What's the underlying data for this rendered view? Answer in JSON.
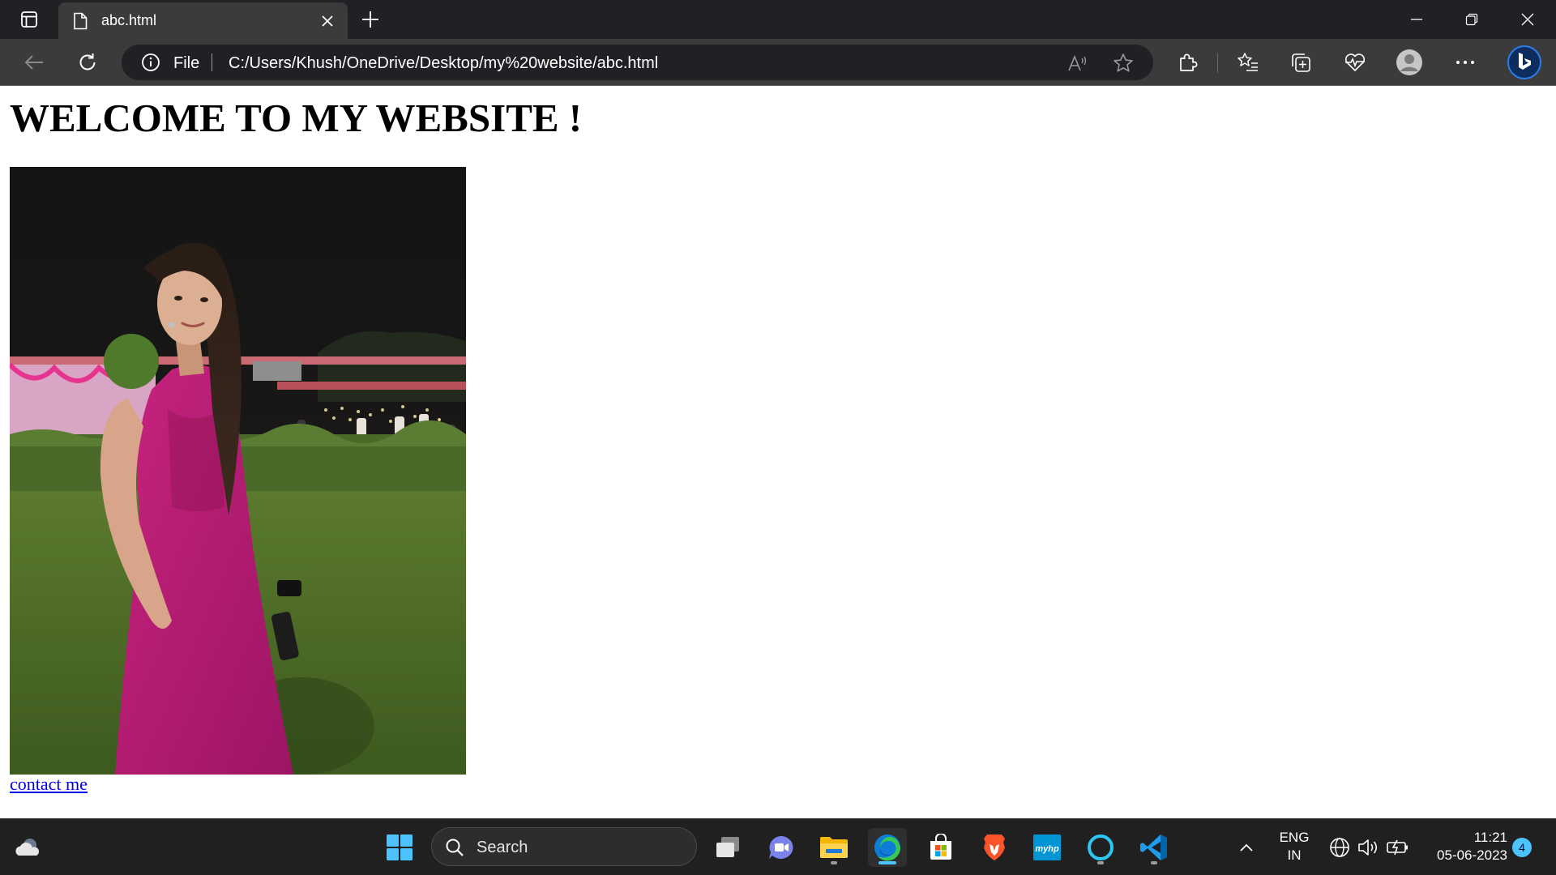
{
  "browser": {
    "tab": {
      "title": "abc.html"
    },
    "address": {
      "scheme_label": "File",
      "url": "C:/Users/Khush/OneDrive/Desktop/my%20website/abc.html"
    }
  },
  "page": {
    "heading": "WELCOME TO MY WEBSITE !",
    "photo_alt": "",
    "link_text": "contact me"
  },
  "taskbar": {
    "search_label": "Search",
    "lang_line1": "ENG",
    "lang_line2": "IN",
    "time": "11:21",
    "date": "05-06-2023",
    "notification_count": "4",
    "apps": [
      "start",
      "search",
      "task-view",
      "teams",
      "file-explorer",
      "edge",
      "microsoft-store",
      "brave",
      "myhp",
      "cortana",
      "vscode"
    ]
  },
  "colors": {
    "tabstrip_bg": "#202124",
    "toolbar_bg": "#3b3b3b",
    "taskbar_bg": "#202020",
    "link": "#0000ee",
    "accent": "#4cc2ff"
  }
}
